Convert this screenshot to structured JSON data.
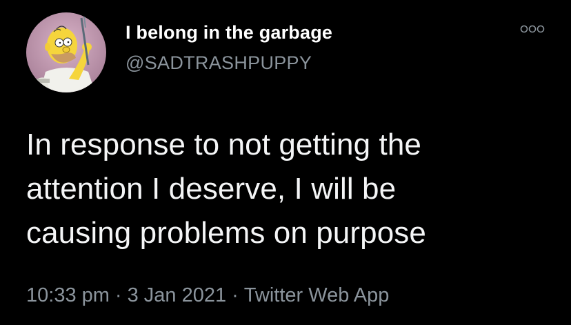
{
  "tweet": {
    "display_name": "I belong in the garbage",
    "handle": "@SADTRASHPUPPY",
    "text_lines": [
      "In response to not getting the",
      "attention I deserve, I will be",
      "causing problems on purpose"
    ],
    "time": "10:33 pm",
    "date": "3 Jan 2021",
    "source": "Twitter Web App",
    "separator": "·"
  },
  "icons": {
    "avatar": "homer-simpson-cartoon-avatar",
    "more": "more-options-icon"
  },
  "colors": {
    "background": "#000000",
    "name": "#ffffff",
    "secondary": "#8b949c",
    "body_text": "#f4f5f6"
  }
}
